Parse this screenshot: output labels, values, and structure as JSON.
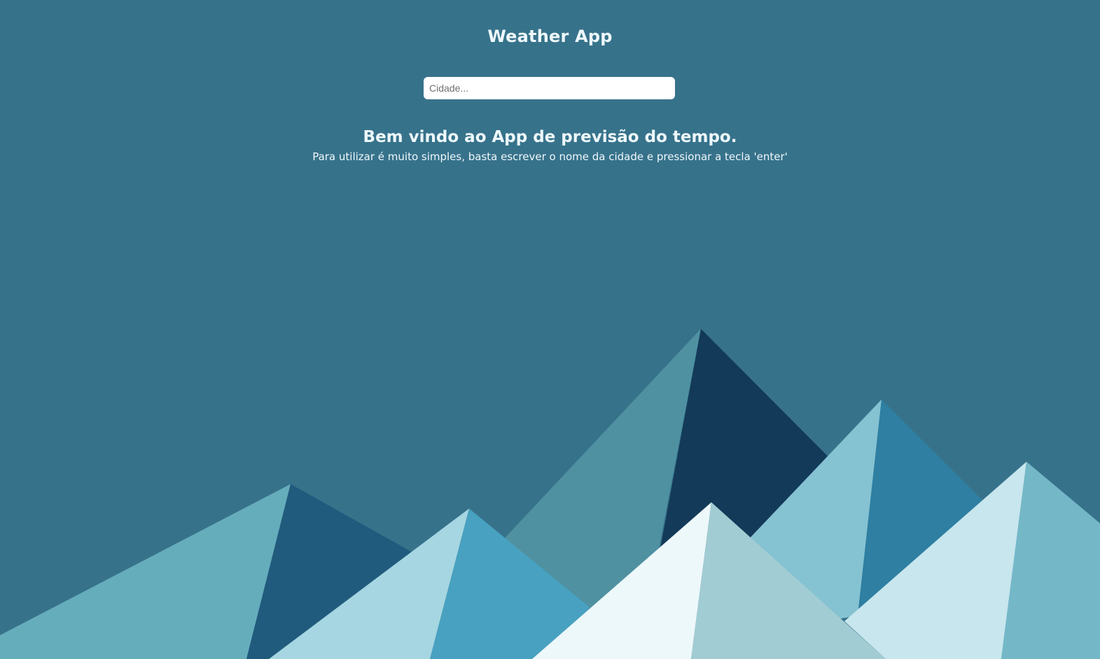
{
  "header": {
    "title": "Weather App"
  },
  "search": {
    "placeholder": "Cidade...",
    "value": ""
  },
  "welcome": {
    "heading": "Bem vindo ao App de previsão do tempo.",
    "instructions": "Para utilizar é muito simples, basta escrever o nome da cidade e pressionar a tecla 'enter'"
  },
  "colors": {
    "background": "#37728b",
    "text": "#eef8fb",
    "mountain_palette": [
      "#66adbb",
      "#205b7d",
      "#4f91a1",
      "#133a58",
      "#a6d6e1",
      "#48a1c0",
      "#85c2d2",
      "#2e7fa2",
      "#edf8fa",
      "#a2ccd3",
      "#c7e6ed",
      "#74b8c8"
    ]
  }
}
